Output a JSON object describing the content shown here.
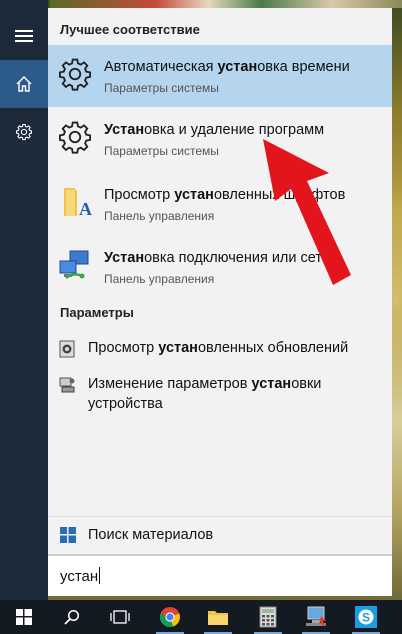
{
  "search": {
    "query": "устан"
  },
  "sections": {
    "best_match": "Лучшее соответствие",
    "settings": "Параметры"
  },
  "best_matches": [
    {
      "pre": "Автоматическая ",
      "bold": "устан",
      "post": "овка времени",
      "subtitle": "Параметры системы",
      "icon": "gear-icon",
      "selected": true
    },
    {
      "pre": "",
      "bold": "Устан",
      "post": "овка и удаление программ",
      "subtitle": "Параметры системы",
      "icon": "gear-icon",
      "selected": false
    },
    {
      "pre": "Просмотр ",
      "bold": "устан",
      "post": "овленных шрифтов",
      "subtitle": "Панель управления",
      "icon": "fonts-folder-icon",
      "selected": false
    },
    {
      "pre": "",
      "bold": "Устан",
      "post": "овка подключения или сети",
      "subtitle": "Панель управления",
      "icon": "network-icon",
      "selected": false
    }
  ],
  "settings_results": [
    {
      "pre": "Просмотр ",
      "bold": "устан",
      "post": "овленных обновлений",
      "icon": "updates-icon"
    },
    {
      "pre": "Изменение параметров ",
      "bold": "устан",
      "post": "овки устройства",
      "icon": "device-settings-icon"
    }
  ],
  "store_search": {
    "label": "Поиск материалов"
  },
  "taskbar": {
    "items": [
      "start-button",
      "search-button",
      "task-view-button",
      "chrome-icon",
      "file-explorer-icon",
      "calculator-icon",
      "remote-desktop-icon",
      "skype-icon"
    ]
  },
  "colors": {
    "accent": "#b5d5ee",
    "rail": "#1d2a3a",
    "rail_active": "#2c5a8a",
    "annotation_arrow": "#e3151c"
  }
}
